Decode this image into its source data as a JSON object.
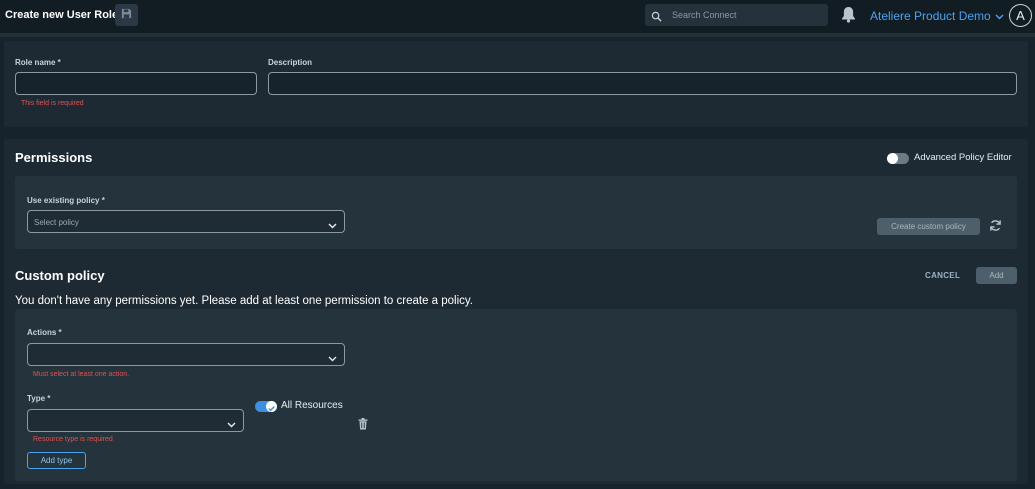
{
  "header": {
    "title": "Create new User Role",
    "search_placeholder": "Search Connect",
    "org_name": "Ateliere Product Demo",
    "avatar_initial": "A"
  },
  "role_form": {
    "role_name_label": "Role name *",
    "role_name_value": "",
    "role_name_error": "This field is required",
    "description_label": "Description",
    "description_value": ""
  },
  "permissions": {
    "title": "Permissions",
    "advanced_editor_label": "Advanced Policy Editor",
    "advanced_editor_on": false,
    "existing_policy_label": "Use existing policy *",
    "existing_policy_placeholder": "Select policy",
    "create_custom_policy_label": "Create custom policy"
  },
  "custom_policy": {
    "title": "Custom policy",
    "cancel_label": "CANCEL",
    "add_label": "Add",
    "empty_message": "You don't have any permissions yet. Please add at least one permission to create a policy.",
    "actions_label": "Actions *",
    "actions_value": "",
    "actions_error": "Must select at least one action.",
    "type_label": "Type *",
    "type_value": "",
    "type_error": "Resource type is required",
    "all_resources_label": "All Resources",
    "all_resources_on": true,
    "add_type_label": "Add type"
  },
  "colors": {
    "accent": "#4ba3f0",
    "error": "#e0524f",
    "toggle_on": "#3d8fe0",
    "toggle_off": "#6c7a85"
  }
}
